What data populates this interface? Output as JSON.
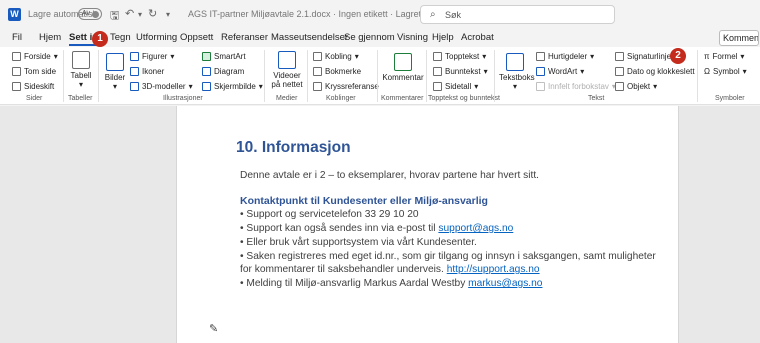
{
  "titlebar": {
    "app_logo": "W",
    "autosave_label": "Lagre automatisk",
    "autosave_state": "Av",
    "doc_title": "AGS IT-partner Miljøavtale 2.1.docx  ·  Ingen etikett  ·  Lagret",
    "search_placeholder": "Søk"
  },
  "tabs": [
    "Fil",
    "Hjem",
    "Sett inn",
    "Tegn",
    "Utforming",
    "Oppsett",
    "Referanser",
    "Masseutsendelser",
    "Se gjennom",
    "Visning",
    "Hjelp",
    "Acrobat"
  ],
  "active_tab": "Sett inn",
  "badges": {
    "b1": "1",
    "b2": "2"
  },
  "comments_button": "Kommentarer",
  "ribbon": {
    "sider": {
      "forside": "Forside",
      "tom_side": "Tom side",
      "sideskift": "Sideskift",
      "group": "Sider"
    },
    "tabeller": {
      "tabell": "Tabell",
      "group": "Tabeller"
    },
    "illustrasjoner": {
      "bilder": "Bilder",
      "figurer": "Figurer",
      "ikoner": "Ikoner",
      "modeller": "3D-modeller",
      "smartart": "SmartArt",
      "diagram": "Diagram",
      "skjermbilde": "Skjermbilde",
      "group": "Illustrasjoner"
    },
    "medier": {
      "videoer": "Videoer",
      "videoer2": "på nettet",
      "group": "Medier"
    },
    "koblinger": {
      "kobling": "Kobling",
      "bokmerke": "Bokmerke",
      "kryssref": "Kryssreferanse",
      "group": "Koblinger"
    },
    "kommentarer": {
      "kommentar": "Kommentar",
      "group": "Kommentarer"
    },
    "topptekst": {
      "topptekst": "Topptekst",
      "bunntekst": "Bunntekst",
      "sidetall": "Sidetall",
      "group": "Topptekst og bunntekst"
    },
    "tekst": {
      "tekstboks": "Tekstboks",
      "hurtigdeler": "Hurtigdeler",
      "wordart": "WordArt",
      "innfelt": "Innfelt forbokstav",
      "signatur": "Signaturlinje",
      "dato": "Dato og klokkeslett",
      "objekt": "Objekt",
      "group": "Tekst"
    },
    "symboler": {
      "formel": "Formel",
      "symbol": "Symbol",
      "group": "Symboler"
    }
  },
  "document": {
    "heading": "10. Informasjon",
    "intro": "Denne avtale er i 2 – to eksemplarer, hvorav partene har hvert sitt.",
    "subheading": "Kontaktpunkt til Kundesenter eller Miljø-ansvarlig",
    "line1": "• Support og servicetelefon 33 29 10 20",
    "line2_pre": "• Support kan også sendes inn via e-post til ",
    "line2_link": "support@ags.no",
    "line3": "• Eller bruk vårt supportsystem via vårt Kundesenter.",
    "line4": "• Saken registreres med eget id.nr., som gir tilgang og innsyn i saksgangen, samt muligheter",
    "line5_pre": "for kommentarer til saksbehandler underveis. ",
    "line5_link": "http://support.ags.no",
    "line6_pre": "• Melding til Miljø-ansvarlig Markus Aardal Westby ",
    "line6_link": "markus@ags.no"
  },
  "colors": {
    "accent": "#185abd",
    "heading": "#2f5496",
    "link": "#0563c1",
    "badge": "#c42b1c"
  }
}
